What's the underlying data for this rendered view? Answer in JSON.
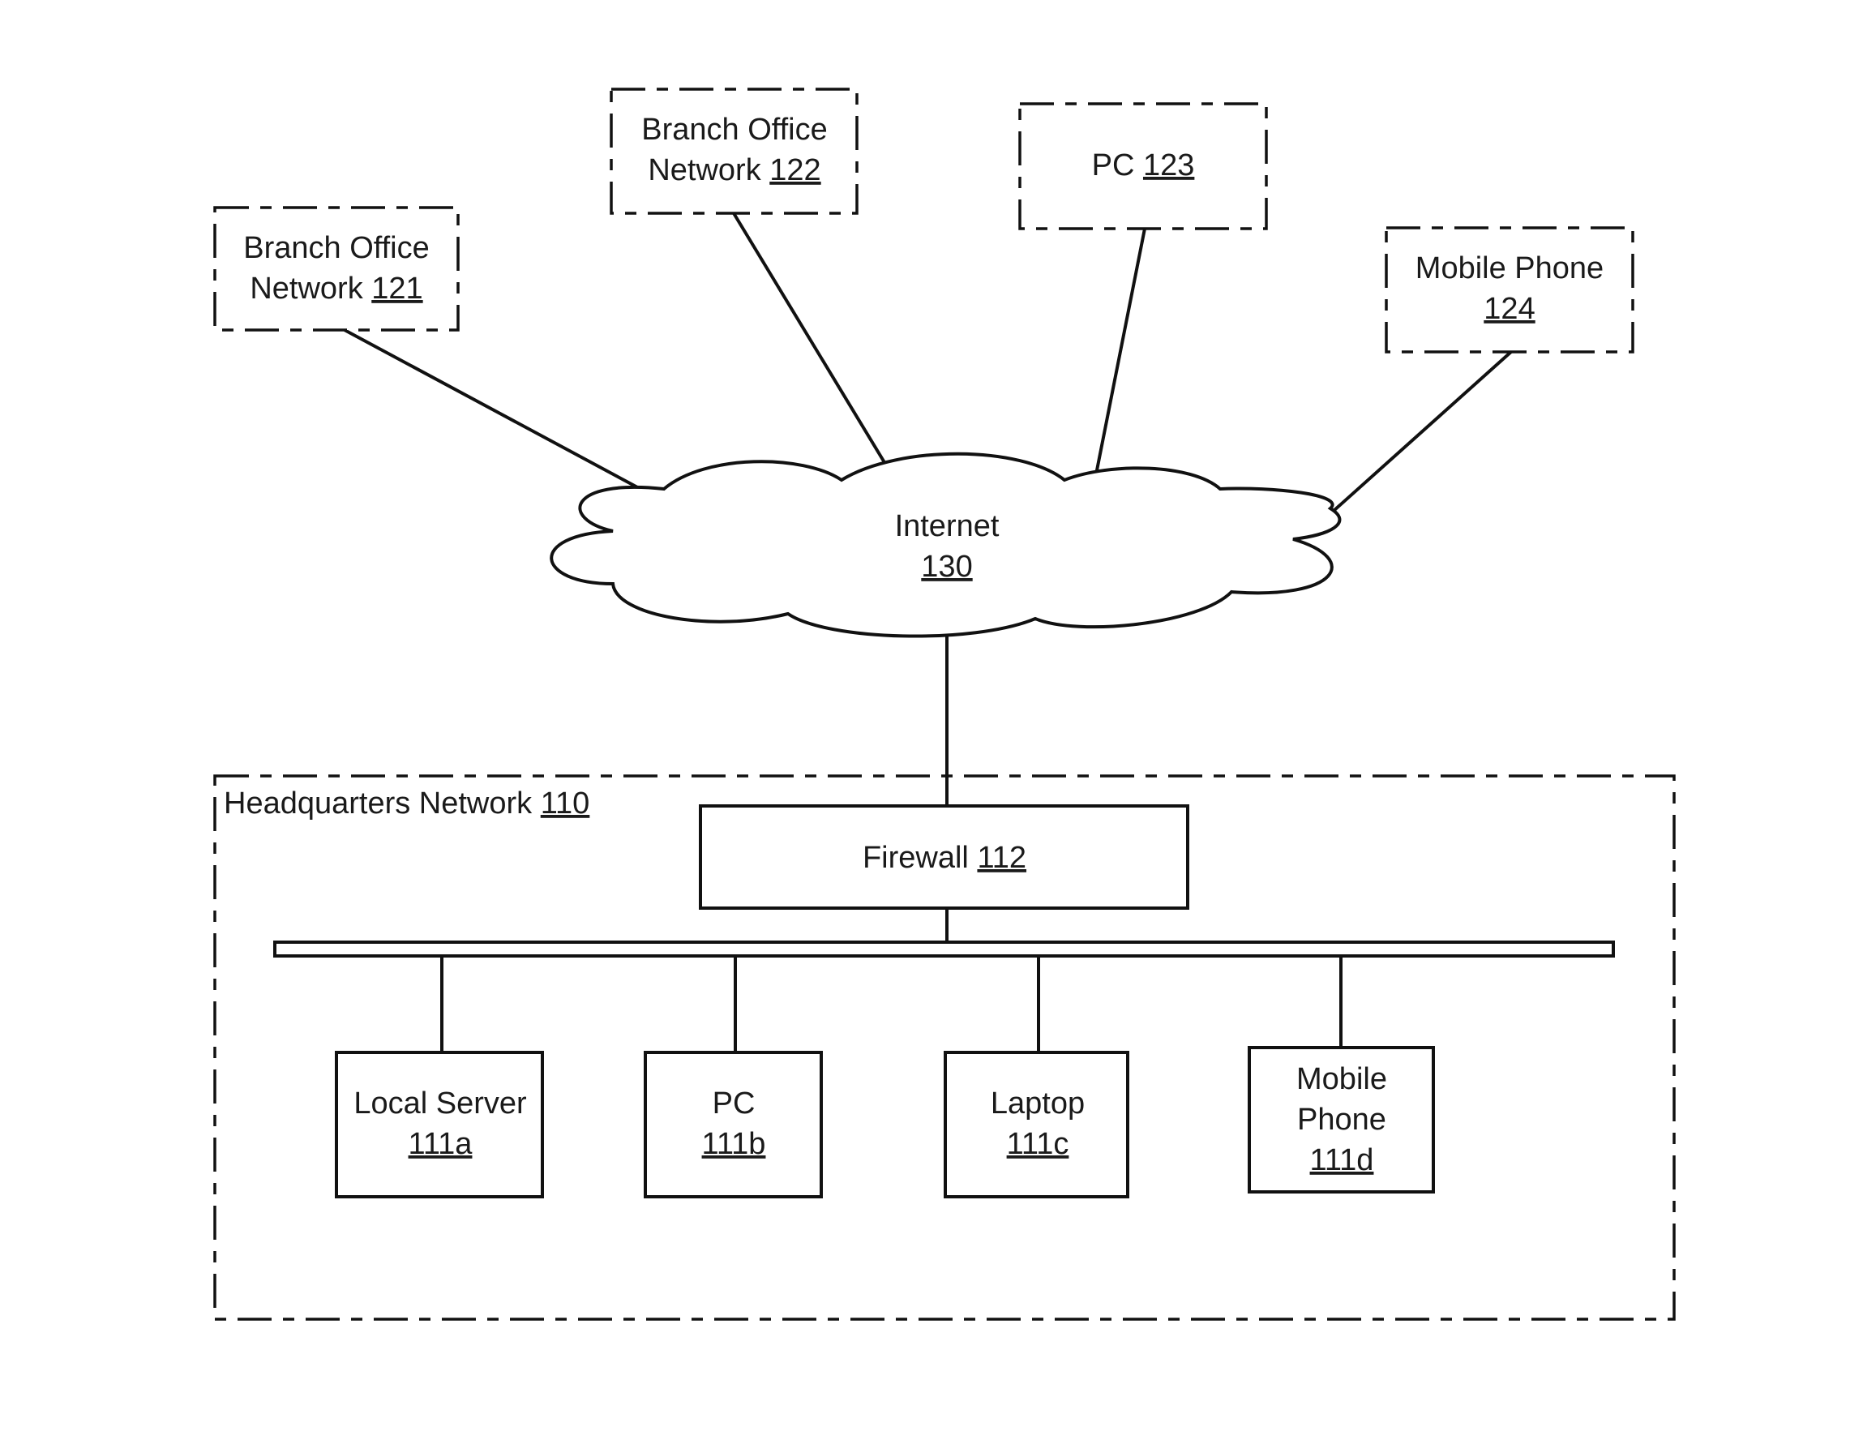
{
  "diagram": {
    "type": "network-topology",
    "remote_nodes": [
      {
        "id": "branch-121",
        "line1": "Branch Office",
        "line2_text": "Network ",
        "ref": "121",
        "border": "dashed"
      },
      {
        "id": "branch-122",
        "line1": "Branch Office",
        "line2_text": "Network ",
        "ref": "122",
        "border": "dashed"
      },
      {
        "id": "pc-123",
        "line1_text": "PC ",
        "ref": "123",
        "border": "dashed"
      },
      {
        "id": "mobile-124",
        "line1": "Mobile Phone",
        "ref": "124",
        "border": "dashed"
      }
    ],
    "internet": {
      "label": "Internet",
      "ref": "130",
      "shape": "cloud"
    },
    "headquarters": {
      "label_text": "Headquarters Network ",
      "ref": "110",
      "border": "dashed",
      "firewall": {
        "label_text": "Firewall ",
        "ref": "112"
      },
      "devices": [
        {
          "id": "local-server",
          "line1": "Local Server",
          "ref": "111a"
        },
        {
          "id": "pc",
          "line1": "PC",
          "ref": "111b"
        },
        {
          "id": "laptop",
          "line1": "Laptop",
          "ref": "111c"
        },
        {
          "id": "mobile-phone",
          "line1": "Mobile",
          "line2": "Phone",
          "ref": "111d"
        }
      ]
    },
    "connections": [
      [
        "branch-121",
        "internet"
      ],
      [
        "branch-122",
        "internet"
      ],
      [
        "pc-123",
        "internet"
      ],
      [
        "mobile-124",
        "internet"
      ],
      [
        "internet",
        "firewall"
      ],
      [
        "firewall",
        "lan-bus"
      ],
      [
        "lan-bus",
        "local-server"
      ],
      [
        "lan-bus",
        "pc"
      ],
      [
        "lan-bus",
        "laptop"
      ],
      [
        "lan-bus",
        "mobile-phone"
      ]
    ]
  }
}
